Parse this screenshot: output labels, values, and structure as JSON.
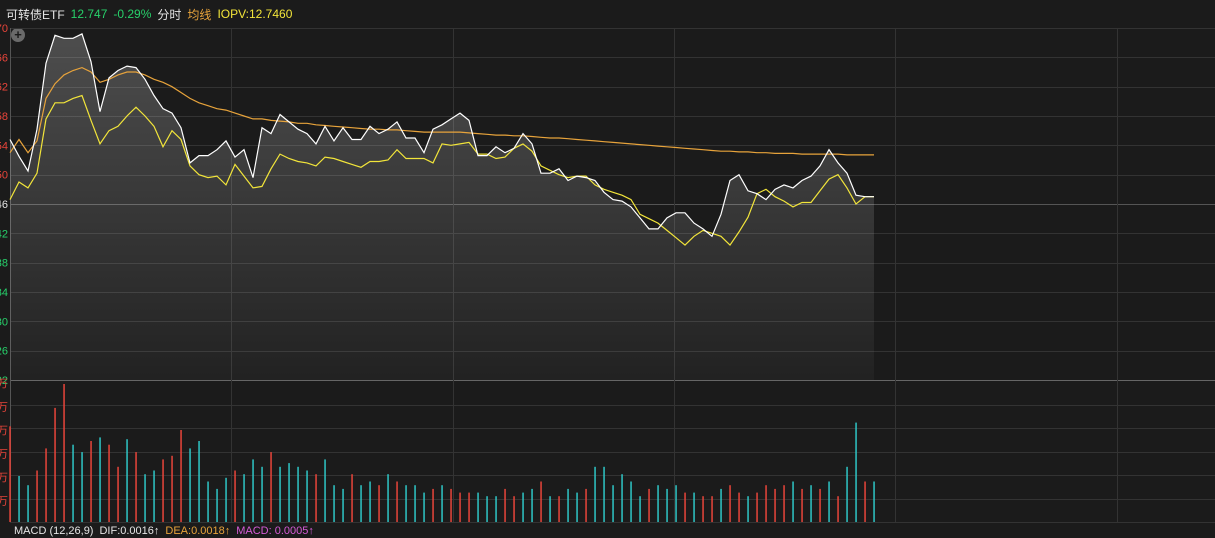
{
  "header": {
    "name": "可转债ETF",
    "price": "12.747",
    "change": "-0.29%",
    "mode": "分时",
    "avg_label": "均线",
    "iopv": "IOPV:12.7460"
  },
  "footer": {
    "macd": "MACD (12,26,9)",
    "dif": "DIF:0.0016",
    "dif_arrow": "↑",
    "dea": "DEA:0.0018",
    "dea_arrow": "↑",
    "macd_val": "MACD: 0.0005",
    "macd_arrow": "↑"
  },
  "colors": {
    "background": "#1b1b1b",
    "price_line": "#ffffff",
    "avg_line": "#e7a33b",
    "iopv_line": "#f2e53a",
    "up": "#e8443a",
    "down": "#2fc6c6",
    "grid": "#333333"
  },
  "chart_data": {
    "type": "line",
    "x_count": 97,
    "y_tick_label_colors": [
      "#e8443a",
      "#e8443a",
      "#e8443a",
      "#e8443a",
      "#e8443a",
      "#e8443a",
      "#e6e6e6",
      "#27d06a",
      "#27d06a",
      "#27d06a",
      "#27d06a",
      "#27d06a",
      "#27d06a"
    ],
    "ylim": [
      12.722,
      12.77
    ],
    "baseline": 12.754,
    "series": [
      {
        "values": [
          12.7548,
          12.7525,
          12.7505,
          12.7562,
          12.7652,
          12.769,
          12.7686,
          12.7686,
          12.7692,
          12.7654,
          12.7586,
          12.7632,
          12.7642,
          12.7648,
          12.7646,
          12.763,
          12.7608,
          12.759,
          12.7584,
          12.7564,
          12.7516,
          12.7526,
          12.7526,
          12.7534,
          12.7546,
          12.7524,
          12.7534,
          12.7496,
          12.7564,
          12.7556,
          12.7582,
          12.7572,
          12.7562,
          12.7556,
          12.7542,
          12.7566,
          12.7546,
          12.7564,
          12.7548,
          12.7548,
          12.7566,
          12.7556,
          12.7562,
          12.7572,
          12.755,
          12.755,
          12.753,
          12.7562,
          12.7568,
          12.7576,
          12.7584,
          12.7574,
          12.7526,
          12.7526,
          12.7538,
          12.753,
          12.7536,
          12.7556,
          12.7542,
          12.7502,
          12.7502,
          12.7508,
          12.7492,
          12.7498,
          12.7496,
          12.7492,
          12.7476,
          12.7466,
          12.7464,
          12.7456,
          12.7441,
          12.7426,
          12.7426,
          12.7441,
          12.7448,
          12.7448,
          12.7434,
          12.7426,
          12.7416,
          12.7446,
          12.7492,
          12.75,
          12.7478,
          12.7474,
          12.7466,
          12.748,
          12.7486,
          12.7482,
          12.7492,
          12.7498,
          12.7512,
          12.7534,
          12.7516,
          12.7502,
          12.7472,
          12.747,
          12.747
        ]
      },
      {
        "values": [
          12.753,
          12.7548,
          12.753,
          12.7546,
          12.7604,
          12.7624,
          12.7636,
          12.7642,
          12.7646,
          12.764,
          12.7626,
          12.763,
          12.7636,
          12.764,
          12.764,
          12.7636,
          12.763,
          12.7626,
          12.762,
          12.7612,
          12.7604,
          12.7598,
          12.7594,
          12.759,
          12.7588,
          12.7584,
          12.758,
          12.7576,
          12.7576,
          12.7574,
          12.7573,
          12.7572,
          12.757,
          12.757,
          12.7568,
          12.7567,
          12.7566,
          12.7565,
          12.7564,
          12.7563,
          12.7562,
          12.7562,
          12.7561,
          12.7561,
          12.756,
          12.7559,
          12.7558,
          12.7558,
          12.7558,
          12.7558,
          12.7558,
          12.7557,
          12.7556,
          12.7555,
          12.7554,
          12.7554,
          12.7553,
          12.7553,
          12.7552,
          12.7551,
          12.755,
          12.755,
          12.7549,
          12.7548,
          12.7547,
          12.7546,
          12.7545,
          12.7544,
          12.7543,
          12.7542,
          12.7541,
          12.754,
          12.7539,
          12.7538,
          12.7537,
          12.7536,
          12.7535,
          12.7534,
          12.7533,
          12.7532,
          12.7532,
          12.7531,
          12.7531,
          12.753,
          12.753,
          12.7529,
          12.7529,
          12.7529,
          12.7528,
          12.7528,
          12.7528,
          12.7528,
          12.7528,
          12.7527,
          12.7527,
          12.7527,
          12.7527
        ]
      },
      {
        "values": [
          12.7466,
          12.749,
          12.7482,
          12.7502,
          12.7576,
          12.7598,
          12.7598,
          12.7604,
          12.7608,
          12.7574,
          12.7542,
          12.756,
          12.7566,
          12.758,
          12.7592,
          12.758,
          12.7566,
          12.7538,
          12.756,
          12.7548,
          12.7512,
          12.75,
          12.7496,
          12.7498,
          12.7486,
          12.7514,
          12.7498,
          12.7482,
          12.7484,
          12.7508,
          12.7528,
          12.7522,
          12.7518,
          12.7516,
          12.7512,
          12.7524,
          12.7522,
          12.7518,
          12.7514,
          12.751,
          12.7518,
          12.7518,
          12.752,
          12.7534,
          12.7522,
          12.7522,
          12.7522,
          12.7516,
          12.7542,
          12.754,
          12.7542,
          12.7544,
          12.7528,
          12.7528,
          12.7522,
          12.7524,
          12.7536,
          12.7542,
          12.7532,
          12.7512,
          12.7506,
          12.75,
          12.7496,
          12.7498,
          12.7498,
          12.7486,
          12.748,
          12.7476,
          12.7472,
          12.7466,
          12.7446,
          12.744,
          12.7434,
          12.7424,
          12.7414,
          12.7404,
          12.7416,
          12.7424,
          12.742,
          12.7416,
          12.7404,
          12.7422,
          12.7442,
          12.7474,
          12.748,
          12.747,
          12.7464,
          12.7456,
          12.7462,
          12.7462,
          12.7478,
          12.7494,
          12.75,
          12.7482,
          12.746,
          12.747,
          12.747
        ]
      }
    ],
    "volume": {
      "values": [
        52,
        25,
        20,
        28,
        40,
        62,
        75,
        42,
        38,
        44,
        46,
        42,
        30,
        45,
        38,
        26,
        28,
        34,
        36,
        50,
        40,
        44,
        22,
        18,
        24,
        28,
        26,
        34,
        30,
        38,
        30,
        32,
        30,
        28,
        26,
        34,
        20,
        18,
        26,
        20,
        22,
        20,
        26,
        22,
        20,
        20,
        16,
        18,
        20,
        18,
        16,
        16,
        16,
        14,
        14,
        18,
        14,
        16,
        18,
        22,
        14,
        14,
        18,
        16,
        18,
        30,
        30,
        20,
        26,
        22,
        14,
        18,
        20,
        18,
        20,
        16,
        16,
        14,
        14,
        18,
        20,
        16,
        14,
        16,
        20,
        18,
        20,
        22,
        18,
        20,
        18,
        22,
        14,
        30,
        54,
        22,
        22
      ],
      "up": [
        true,
        false,
        false,
        true,
        true,
        true,
        true,
        false,
        false,
        true,
        false,
        true,
        true,
        false,
        true,
        false,
        false,
        true,
        true,
        true,
        false,
        false,
        false,
        false,
        false,
        true,
        false,
        false,
        false,
        true,
        false,
        false,
        false,
        false,
        true,
        false,
        false,
        false,
        true,
        false,
        false,
        true,
        false,
        true,
        false,
        false,
        false,
        true,
        false,
        true,
        true,
        true,
        false,
        false,
        false,
        true,
        true,
        false,
        false,
        true,
        false,
        true,
        false,
        false,
        true,
        false,
        false,
        false,
        false,
        false,
        false,
        true,
        false,
        false,
        false,
        true,
        false,
        true,
        true,
        false,
        true,
        true,
        false,
        true,
        true,
        true,
        true,
        false,
        true,
        false,
        true,
        false,
        true,
        false,
        false,
        true,
        false
      ]
    }
  }
}
